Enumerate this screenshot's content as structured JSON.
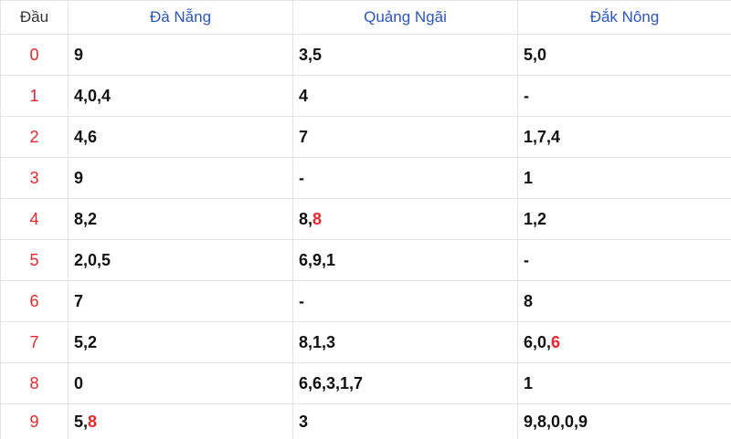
{
  "colors": {
    "head_digit": "#e8262b",
    "province": "#2a55c4",
    "highlight": "#e8262b",
    "border": "#e3e3e3"
  },
  "table": {
    "header": {
      "head": "Đầu",
      "provinces": [
        "Đà Nẵng",
        "Quảng Ngãi",
        "Đắk Nông"
      ]
    },
    "rows": [
      {
        "head": "0",
        "cells": [
          [
            {
              "t": "9"
            }
          ],
          [
            {
              "t": "3,5"
            }
          ],
          [
            {
              "t": "5,0"
            }
          ]
        ]
      },
      {
        "head": "1",
        "cells": [
          [
            {
              "t": "4,0,4"
            }
          ],
          [
            {
              "t": "4"
            }
          ],
          [
            {
              "t": "-"
            }
          ]
        ]
      },
      {
        "head": "2",
        "cells": [
          [
            {
              "t": "4,6"
            }
          ],
          [
            {
              "t": "7"
            }
          ],
          [
            {
              "t": "1,7,4"
            }
          ]
        ]
      },
      {
        "head": "3",
        "cells": [
          [
            {
              "t": "9"
            }
          ],
          [
            {
              "t": "-"
            }
          ],
          [
            {
              "t": "1"
            }
          ]
        ]
      },
      {
        "head": "4",
        "cells": [
          [
            {
              "t": "8,2"
            }
          ],
          [
            {
              "t": "8,"
            },
            {
              "t": "8",
              "red": true
            }
          ],
          [
            {
              "t": "1,2"
            }
          ]
        ]
      },
      {
        "head": "5",
        "cells": [
          [
            {
              "t": "2,0,5"
            }
          ],
          [
            {
              "t": "6,9,1"
            }
          ],
          [
            {
              "t": "-"
            }
          ]
        ]
      },
      {
        "head": "6",
        "cells": [
          [
            {
              "t": "7"
            }
          ],
          [
            {
              "t": "-"
            }
          ],
          [
            {
              "t": "8"
            }
          ]
        ]
      },
      {
        "head": "7",
        "cells": [
          [
            {
              "t": "5,2"
            }
          ],
          [
            {
              "t": "8,1,3"
            }
          ],
          [
            {
              "t": "6,0,"
            },
            {
              "t": "6",
              "red": true
            }
          ]
        ]
      },
      {
        "head": "8",
        "cells": [
          [
            {
              "t": "0"
            }
          ],
          [
            {
              "t": "6,6,3,1,7"
            }
          ],
          [
            {
              "t": "1"
            }
          ]
        ]
      },
      {
        "head": "9",
        "cells": [
          [
            {
              "t": "5,"
            },
            {
              "t": "8",
              "red": true
            }
          ],
          [
            {
              "t": "3"
            }
          ],
          [
            {
              "t": "9,8,0,0,9"
            }
          ]
        ]
      }
    ]
  }
}
